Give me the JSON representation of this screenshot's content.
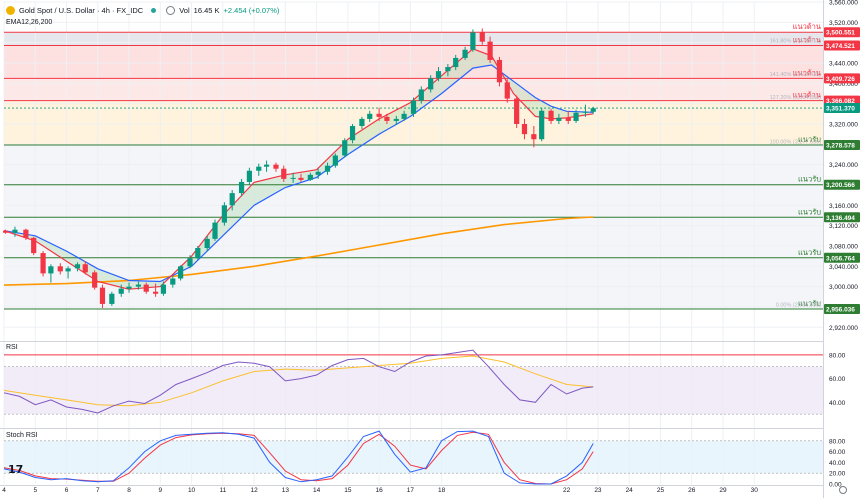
{
  "header": {
    "symbol": "Gold Spot / U.S. Dollar · 4h · FX_IDC",
    "volume_label": "Vol",
    "volume_value": "16.45 K",
    "change": "+2.454 (+0.07%)",
    "ema_label": "EMA12,26,200"
  },
  "panes": {
    "rsi_label": "RSI",
    "stoch_label": "Stoch RSI"
  },
  "logo_text": "17",
  "colors": {
    "bull": "#089981",
    "bear": "#f23645",
    "resistance": "#f23645",
    "support": "#2e7d32",
    "ema_fast": "#f23645",
    "ema_slow": "#2962ff",
    "ema_200": "#ff9800",
    "rsi_line": "#7e57c2",
    "rsi_ma": "#fbc02d",
    "stoch_k": "#2962ff",
    "stoch_d": "#f23645"
  },
  "chart_data": {
    "type": "candlestick",
    "price_axis": {
      "range": [
        2895,
        3560
      ],
      "ticks": [
        "3,560.000",
        "3,520.000",
        "3,480.000",
        "3,440.000",
        "3,400.000",
        "3,360.000",
        "3,320.000",
        "3,280.000",
        "3,240.000",
        "3,200.000",
        "3,160.000",
        "3,120.000",
        "3,080.000",
        "3,040.000",
        "3,000.000",
        "2,960.000",
        "2,920.000"
      ]
    },
    "time_axis": {
      "range": [
        4,
        30.2
      ],
      "ticks": [
        {
          "label": "4",
          "x": 4
        },
        {
          "label": "5",
          "x": 5
        },
        {
          "label": "6",
          "x": 6
        },
        {
          "label": "7",
          "x": 7
        },
        {
          "label": "8",
          "x": 8
        },
        {
          "label": "9",
          "x": 9
        },
        {
          "label": "10",
          "x": 10
        },
        {
          "label": "11",
          "x": 11
        },
        {
          "label": "12",
          "x": 12
        },
        {
          "label": "13",
          "x": 13
        },
        {
          "label": "14",
          "x": 14
        },
        {
          "label": "15",
          "x": 15
        },
        {
          "label": "16",
          "x": 16
        },
        {
          "label": "17",
          "x": 17
        },
        {
          "label": "18",
          "x": 18
        },
        {
          "label": "22",
          "x": 22
        },
        {
          "label": "23",
          "x": 23
        },
        {
          "label": "24",
          "x": 24
        },
        {
          "label": "25",
          "x": 25
        },
        {
          "label": "26",
          "x": 26
        },
        {
          "label": "29",
          "x": 27
        },
        {
          "label": "30",
          "x": 28
        }
      ]
    },
    "levels": [
      {
        "label": "แนวต้าน",
        "value": 3500.551,
        "text": "3,500.551",
        "kind": "resistance"
      },
      {
        "label": "แนวต้าน",
        "value": 3474.521,
        "text": "3,474.521",
        "kind": "resistance"
      },
      {
        "label": "แนวต้าน",
        "value": 3409.726,
        "text": "3,409.726",
        "kind": "resistance"
      },
      {
        "label": "แนวต้าน",
        "value": 3366.082,
        "text": "3,366.082",
        "kind": "resistance"
      },
      {
        "label": "แนวรับ",
        "value": 3278.578,
        "text": "3,278.578",
        "kind": "support"
      },
      {
        "label": "แนวรับ",
        "value": 3200.566,
        "text": "3,200.566",
        "kind": "support"
      },
      {
        "label": "แนวรับ",
        "value": 3136.494,
        "text": "3,136.494",
        "kind": "support"
      },
      {
        "label": "แนวรับ",
        "value": 3056.764,
        "text": "3,056.764",
        "kind": "support"
      },
      {
        "label": "แนวรับ",
        "value": 2956.036,
        "text": "2,956.036",
        "kind": "support"
      }
    ],
    "current_price": {
      "value": 3351.37,
      "text": "3,351.370"
    },
    "fib_levels": [
      {
        "text": "161.80% (3,475.912)",
        "value": 3475.912
      },
      {
        "text": "141.40% (3,410.435)",
        "value": 3410.435
      },
      {
        "text": "127.20% (3,364.858)",
        "value": 3364.858
      },
      {
        "text": "100.00% (3,277.556)",
        "value": 3277.556
      },
      {
        "text": "0.00% (2,956.590)",
        "value": 2956.59
      }
    ],
    "candles": [
      [
        4.05,
        3110,
        3112,
        3104,
        3106
      ],
      [
        4.35,
        3106,
        3118,
        3098,
        3112
      ],
      [
        4.7,
        3112,
        3114,
        3092,
        3096
      ],
      [
        4.95,
        3096,
        3098,
        3062,
        3066
      ],
      [
        5.25,
        3066,
        3070,
        3020,
        3026
      ],
      [
        5.5,
        3026,
        3044,
        3008,
        3040
      ],
      [
        5.8,
        3040,
        3046,
        3024,
        3030
      ],
      [
        6.05,
        3030,
        3040,
        3016,
        3036
      ],
      [
        6.35,
        3036,
        3048,
        3030,
        3044
      ],
      [
        6.6,
        3044,
        3050,
        3024,
        3028
      ],
      [
        6.9,
        3028,
        3032,
        2994,
        2998
      ],
      [
        7.15,
        2998,
        3004,
        2958,
        2966
      ],
      [
        7.45,
        2966,
        2990,
        2962,
        2986
      ],
      [
        7.75,
        2986,
        3004,
        2980,
        2996
      ],
      [
        8.0,
        2996,
        3008,
        2988,
        3000
      ],
      [
        8.3,
        3000,
        3010,
        2994,
        3004
      ],
      [
        8.55,
        3004,
        3008,
        2986,
        2990
      ],
      [
        8.85,
        2990,
        3006,
        2980,
        2986
      ],
      [
        9.1,
        2986,
        3010,
        2982,
        3004
      ],
      [
        9.4,
        3004,
        3020,
        2998,
        3016
      ],
      [
        9.65,
        3016,
        3042,
        3012,
        3040
      ],
      [
        9.95,
        3040,
        3062,
        3036,
        3056
      ],
      [
        10.2,
        3056,
        3080,
        3052,
        3076
      ],
      [
        10.5,
        3076,
        3100,
        3070,
        3094
      ],
      [
        10.75,
        3094,
        3132,
        3090,
        3126
      ],
      [
        11.05,
        3126,
        3166,
        3120,
        3160
      ],
      [
        11.3,
        3160,
        3190,
        3150,
        3184
      ],
      [
        11.6,
        3184,
        3212,
        3178,
        3206
      ],
      [
        11.85,
        3206,
        3234,
        3200,
        3228
      ],
      [
        12.15,
        3228,
        3242,
        3218,
        3236
      ],
      [
        12.4,
        3236,
        3248,
        3226,
        3240
      ],
      [
        12.7,
        3240,
        3244,
        3226,
        3232
      ],
      [
        12.95,
        3232,
        3238,
        3206,
        3212
      ],
      [
        13.25,
        3212,
        3224,
        3204,
        3214
      ],
      [
        13.5,
        3214,
        3222,
        3206,
        3210
      ],
      [
        13.8,
        3210,
        3224,
        3208,
        3220
      ],
      [
        14.05,
        3220,
        3232,
        3212,
        3226
      ],
      [
        14.35,
        3226,
        3244,
        3220,
        3238
      ],
      [
        14.6,
        3238,
        3262,
        3234,
        3258
      ],
      [
        14.9,
        3258,
        3292,
        3254,
        3288
      ],
      [
        15.15,
        3288,
        3320,
        3282,
        3316
      ],
      [
        15.45,
        3316,
        3334,
        3310,
        3330
      ],
      [
        15.7,
        3330,
        3346,
        3324,
        3340
      ],
      [
        16.0,
        3340,
        3352,
        3326,
        3334
      ],
      [
        16.25,
        3334,
        3340,
        3320,
        3326
      ],
      [
        16.55,
        3326,
        3336,
        3318,
        3330
      ],
      [
        16.8,
        3330,
        3346,
        3326,
        3340
      ],
      [
        17.1,
        3340,
        3372,
        3334,
        3366
      ],
      [
        17.35,
        3366,
        3394,
        3360,
        3388
      ],
      [
        17.65,
        3388,
        3416,
        3382,
        3410
      ],
      [
        17.9,
        3410,
        3432,
        3404,
        3424
      ],
      [
        18.2,
        3424,
        3438,
        3414,
        3432
      ],
      [
        18.45,
        3432,
        3456,
        3426,
        3450
      ],
      [
        18.75,
        3450,
        3472,
        3446,
        3466
      ],
      [
        19.0,
        3466,
        3506,
        3462,
        3500
      ],
      [
        19.3,
        3500,
        3508,
        3476,
        3482
      ],
      [
        19.55,
        3482,
        3492,
        3440,
        3446
      ],
      [
        19.85,
        3446,
        3452,
        3394,
        3402
      ],
      [
        20.1,
        3402,
        3408,
        3362,
        3370
      ],
      [
        20.4,
        3370,
        3376,
        3312,
        3320
      ],
      [
        20.65,
        3320,
        3330,
        3290,
        3300
      ],
      [
        20.95,
        3300,
        3316,
        3274,
        3290
      ],
      [
        21.2,
        3290,
        3352,
        3286,
        3346
      ],
      [
        21.5,
        3346,
        3350,
        3320,
        3326
      ],
      [
        21.75,
        3326,
        3340,
        3320,
        3332
      ],
      [
        22.05,
        3332,
        3346,
        3320,
        3326
      ],
      [
        22.3,
        3326,
        3348,
        3322,
        3342
      ],
      [
        22.6,
        3342,
        3358,
        3334,
        3344
      ],
      [
        22.85,
        3344,
        3354,
        3340,
        3351
      ]
    ],
    "ema12": [
      [
        4,
        3110
      ],
      [
        5,
        3090
      ],
      [
        6,
        3050
      ],
      [
        7,
        3010
      ],
      [
        8,
        2995
      ],
      [
        9,
        3000
      ],
      [
        10,
        3060
      ],
      [
        11,
        3140
      ],
      [
        12,
        3205
      ],
      [
        13,
        3220
      ],
      [
        14,
        3230
      ],
      [
        15,
        3290
      ],
      [
        16,
        3330
      ],
      [
        17,
        3362
      ],
      [
        18,
        3415
      ],
      [
        19,
        3468
      ],
      [
        19.6,
        3454
      ],
      [
        20.3,
        3380
      ],
      [
        21,
        3335
      ],
      [
        21.5,
        3330
      ],
      [
        22,
        3332
      ],
      [
        22.85,
        3340
      ]
    ],
    "ema26": [
      [
        4,
        3110
      ],
      [
        5,
        3100
      ],
      [
        6,
        3070
      ],
      [
        7,
        3035
      ],
      [
        8,
        3012
      ],
      [
        9,
        3010
      ],
      [
        10,
        3040
      ],
      [
        11,
        3100
      ],
      [
        12,
        3160
      ],
      [
        13,
        3195
      ],
      [
        14,
        3215
      ],
      [
        15,
        3260
      ],
      [
        16,
        3300
      ],
      [
        17,
        3335
      ],
      [
        18,
        3380
      ],
      [
        19,
        3430
      ],
      [
        19.6,
        3436
      ],
      [
        20.3,
        3404
      ],
      [
        21,
        3372
      ],
      [
        21.5,
        3355
      ],
      [
        22,
        3345
      ],
      [
        22.85,
        3343
      ]
    ],
    "ema200": [
      [
        4,
        3003
      ],
      [
        6,
        3006
      ],
      [
        8,
        3012
      ],
      [
        10,
        3024
      ],
      [
        12,
        3040
      ],
      [
        14,
        3060
      ],
      [
        16,
        3082
      ],
      [
        18,
        3104
      ],
      [
        20,
        3122
      ],
      [
        22,
        3134
      ],
      [
        22.85,
        3137
      ]
    ],
    "rsi": {
      "range": [
        20,
        90
      ],
      "ticks": [
        "80.00",
        "60.00",
        "40.00"
      ],
      "bands": [
        30,
        70
      ],
      "overbought": 80,
      "values": [
        [
          4,
          48
        ],
        [
          4.5,
          45
        ],
        [
          5,
          38
        ],
        [
          5.5,
          42
        ],
        [
          6,
          36
        ],
        [
          6.5,
          34
        ],
        [
          7,
          31
        ],
        [
          7.5,
          37
        ],
        [
          8,
          41
        ],
        [
          8.5,
          39
        ],
        [
          9,
          46
        ],
        [
          9.5,
          55
        ],
        [
          10,
          60
        ],
        [
          10.5,
          65
        ],
        [
          11,
          71
        ],
        [
          11.5,
          74
        ],
        [
          12,
          73
        ],
        [
          12.5,
          70
        ],
        [
          13,
          58
        ],
        [
          13.5,
          60
        ],
        [
          14,
          63
        ],
        [
          14.5,
          71
        ],
        [
          15,
          76
        ],
        [
          15.5,
          77
        ],
        [
          16,
          70
        ],
        [
          16.5,
          66
        ],
        [
          17,
          74
        ],
        [
          17.5,
          79
        ],
        [
          18,
          80
        ],
        [
          18.5,
          82
        ],
        [
          19,
          84
        ],
        [
          19.5,
          70
        ],
        [
          20,
          55
        ],
        [
          20.5,
          42
        ],
        [
          21,
          40
        ],
        [
          21.5,
          55
        ],
        [
          22,
          47
        ],
        [
          22.5,
          52
        ],
        [
          22.85,
          53
        ]
      ],
      "ma": [
        [
          4,
          50
        ],
        [
          5,
          46
        ],
        [
          6,
          42
        ],
        [
          7,
          38
        ],
        [
          8,
          37
        ],
        [
          9,
          40
        ],
        [
          10,
          48
        ],
        [
          11,
          58
        ],
        [
          12,
          66
        ],
        [
          13,
          68
        ],
        [
          14,
          67
        ],
        [
          15,
          69
        ],
        [
          16,
          71
        ],
        [
          17,
          73
        ],
        [
          18,
          77
        ],
        [
          19,
          79
        ],
        [
          20,
          74
        ],
        [
          21,
          64
        ],
        [
          22,
          55
        ],
        [
          22.85,
          53
        ]
      ]
    },
    "stoch_rsi": {
      "range": [
        0,
        100
      ],
      "ticks": [
        "80.00",
        "60.00",
        "40.00",
        "20.00",
        "0.00"
      ],
      "bands": [
        20,
        80
      ],
      "k": [
        [
          4,
          28
        ],
        [
          4.5,
          22
        ],
        [
          5,
          12
        ],
        [
          5.5,
          8
        ],
        [
          6,
          10
        ],
        [
          6.5,
          6
        ],
        [
          7,
          4
        ],
        [
          7.5,
          6
        ],
        [
          8,
          30
        ],
        [
          8.5,
          60
        ],
        [
          9,
          80
        ],
        [
          9.5,
          90
        ],
        [
          10,
          92
        ],
        [
          10.5,
          94
        ],
        [
          11,
          95
        ],
        [
          11.5,
          92
        ],
        [
          12,
          85
        ],
        [
          12.5,
          40
        ],
        [
          13,
          12
        ],
        [
          13.5,
          4
        ],
        [
          14,
          8
        ],
        [
          14.5,
          15
        ],
        [
          15,
          50
        ],
        [
          15.5,
          88
        ],
        [
          16,
          98
        ],
        [
          16.5,
          55
        ],
        [
          17,
          22
        ],
        [
          17.5,
          30
        ],
        [
          18,
          80
        ],
        [
          18.5,
          97
        ],
        [
          19,
          98
        ],
        [
          19.5,
          88
        ],
        [
          20,
          20
        ],
        [
          20.5,
          2
        ],
        [
          21,
          0
        ],
        [
          21.5,
          0
        ],
        [
          22,
          15
        ],
        [
          22.5,
          40
        ],
        [
          22.85,
          75
        ]
      ],
      "d": [
        [
          4,
          30
        ],
        [
          4.5,
          25
        ],
        [
          5,
          15
        ],
        [
          5.5,
          10
        ],
        [
          6,
          9
        ],
        [
          6.5,
          7
        ],
        [
          7,
          5
        ],
        [
          7.5,
          5
        ],
        [
          8,
          20
        ],
        [
          8.5,
          48
        ],
        [
          9,
          72
        ],
        [
          9.5,
          86
        ],
        [
          10,
          91
        ],
        [
          10.5,
          93
        ],
        [
          11,
          94
        ],
        [
          11.5,
          93
        ],
        [
          12,
          90
        ],
        [
          12.5,
          58
        ],
        [
          13,
          24
        ],
        [
          13.5,
          8
        ],
        [
          14,
          6
        ],
        [
          14.5,
          10
        ],
        [
          15,
          35
        ],
        [
          15.5,
          75
        ],
        [
          16,
          92
        ],
        [
          16.5,
          70
        ],
        [
          17,
          35
        ],
        [
          17.5,
          28
        ],
        [
          18,
          62
        ],
        [
          18.5,
          90
        ],
        [
          19,
          96
        ],
        [
          19.5,
          92
        ],
        [
          20,
          40
        ],
        [
          20.5,
          8
        ],
        [
          21,
          1
        ],
        [
          21.5,
          0
        ],
        [
          22,
          8
        ],
        [
          22.5,
          28
        ],
        [
          22.85,
          60
        ]
      ]
    }
  }
}
